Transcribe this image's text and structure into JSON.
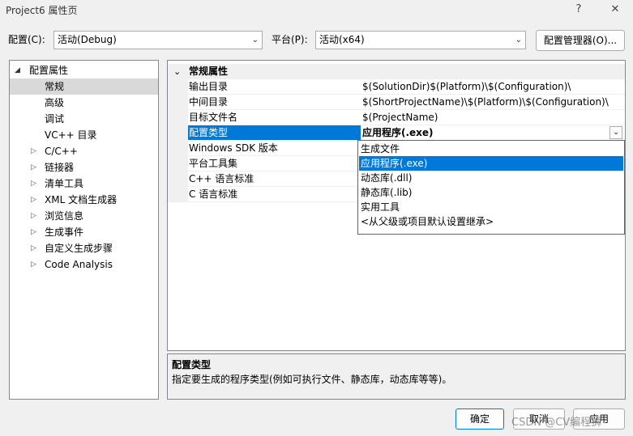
{
  "window": {
    "title": "Project6 属性页",
    "help": "?",
    "close": "✕"
  },
  "config_bar": {
    "config_label": "配置(C):",
    "config_value": "活动(Debug)",
    "platform_label": "平台(P):",
    "platform_value": "活动(x64)",
    "manager_button": "配置管理器(O)..."
  },
  "tree": {
    "root": "配置属性",
    "items": [
      {
        "label": "常规",
        "expandable": false,
        "selected": true
      },
      {
        "label": "高级",
        "expandable": false
      },
      {
        "label": "调试",
        "expandable": false
      },
      {
        "label": "VC++ 目录",
        "expandable": false
      },
      {
        "label": "C/C++",
        "expandable": true
      },
      {
        "label": "链接器",
        "expandable": true
      },
      {
        "label": "清单工具",
        "expandable": true
      },
      {
        "label": "XML 文档生成器",
        "expandable": true
      },
      {
        "label": "浏览信息",
        "expandable": true
      },
      {
        "label": "生成事件",
        "expandable": true
      },
      {
        "label": "自定义生成步骤",
        "expandable": true
      },
      {
        "label": "Code Analysis",
        "expandable": true
      }
    ]
  },
  "grid": {
    "category": "常规属性",
    "properties": [
      {
        "name": "输出目录",
        "value": "$(SolutionDir)$(Platform)\\$(Configuration)\\"
      },
      {
        "name": "中间目录",
        "value": "$(ShortProjectName)\\$(Platform)\\$(Configuration)\\"
      },
      {
        "name": "目标文件名",
        "value": "$(ProjectName)"
      },
      {
        "name": "配置类型",
        "value": "应用程序(.exe)"
      },
      {
        "name": "Windows SDK 版本",
        "value": ""
      },
      {
        "name": "平台工具集",
        "value": ""
      },
      {
        "name": "C++ 语言标准",
        "value": ""
      },
      {
        "name": "C 语言标准",
        "value": ""
      }
    ]
  },
  "dropdown": {
    "options": [
      "生成文件",
      "应用程序(.exe)",
      "动态库(.dll)",
      "静态库(.lib)",
      "实用工具",
      "<从父级或项目默认设置继承>"
    ],
    "selected": "应用程序(.exe)"
  },
  "description": {
    "title": "配置类型",
    "text": "指定要生成的程序类型(例如可执行文件、静态库，动态库等等)。"
  },
  "buttons": {
    "ok": "确定",
    "cancel": "取消",
    "apply": "应用"
  },
  "watermark": "CSDN @CV编程狮"
}
